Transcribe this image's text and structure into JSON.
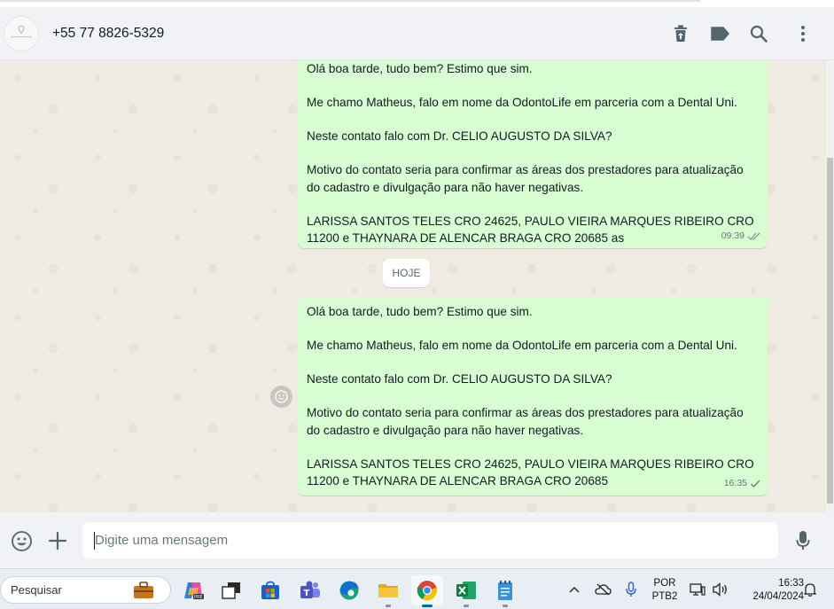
{
  "window": {
    "contact_name": "+55 77 8826-5329"
  },
  "header_icons": [
    "clear-chat-icon",
    "label-icon",
    "search-icon",
    "menu-icon"
  ],
  "messages": [
    {
      "lines": [
        "Olá boa tarde, tudo bem? Estimo que sim.",
        "",
        "Me chamo Matheus, falo em nome da OdontoLife em parceria com a Dental Uni.",
        "",
        "Neste contato falo com Dr. CELIO AUGUSTO DA SILVA?",
        "",
        "Motivo do contato seria para confirmar as áreas dos prestadores para atualização",
        "do cadastro e divulgação para não haver negativas.",
        "",
        "LARISSA SANTOS TELES  CRO 24625, PAULO VIEIRA MARQUES RIBEIRO  CRO",
        "11200 e THAYNARA DE ALENCAR BRAGA  CRO 20685  as"
      ],
      "time": "09:39",
      "status": "read"
    },
    {
      "lines": [
        "Olá boa tarde, tudo bem? Estimo que sim.",
        "",
        "Me chamo Matheus, falo em nome da OdontoLife em parceria com a Dental Uni.",
        "",
        "Neste contato falo com Dr. CELIO AUGUSTO DA SILVA?",
        "",
        "Motivo do contato seria para confirmar as áreas dos prestadores para atualização",
        "do cadastro e divulgação para não haver negativas.",
        "",
        "LARISSA SANTOS TELES  CRO 24625, PAULO VIEIRA MARQUES RIBEIRO  CRO",
        "11200 e THAYNARA DE ALENCAR BRAGA  CRO 20685"
      ],
      "time": "16:35",
      "status": "sent"
    }
  ],
  "date_divider": "HOJE",
  "composer": {
    "placeholder": "Digite uma mensagem",
    "value": ""
  },
  "taskbar": {
    "search_label": "Pesquisar",
    "apps": [
      "copilot-icon",
      "task-view-icon",
      "store-icon",
      "teams-icon",
      "edge-icon",
      "file-explorer-icon",
      "chrome-icon",
      "excel-icon",
      "notepad-icon"
    ],
    "active_app": "chrome-icon",
    "lang_line1": "POR",
    "lang_line2": "PTB2",
    "time": "16:33",
    "date": "24/04/2024"
  },
  "colors": {
    "outgoing_bubble": "#d9fdd3",
    "chat_bg": "#efeae2",
    "header_bg": "#f0f2f5",
    "tick_read": "#8696a0",
    "tick_sent": "#667781"
  }
}
